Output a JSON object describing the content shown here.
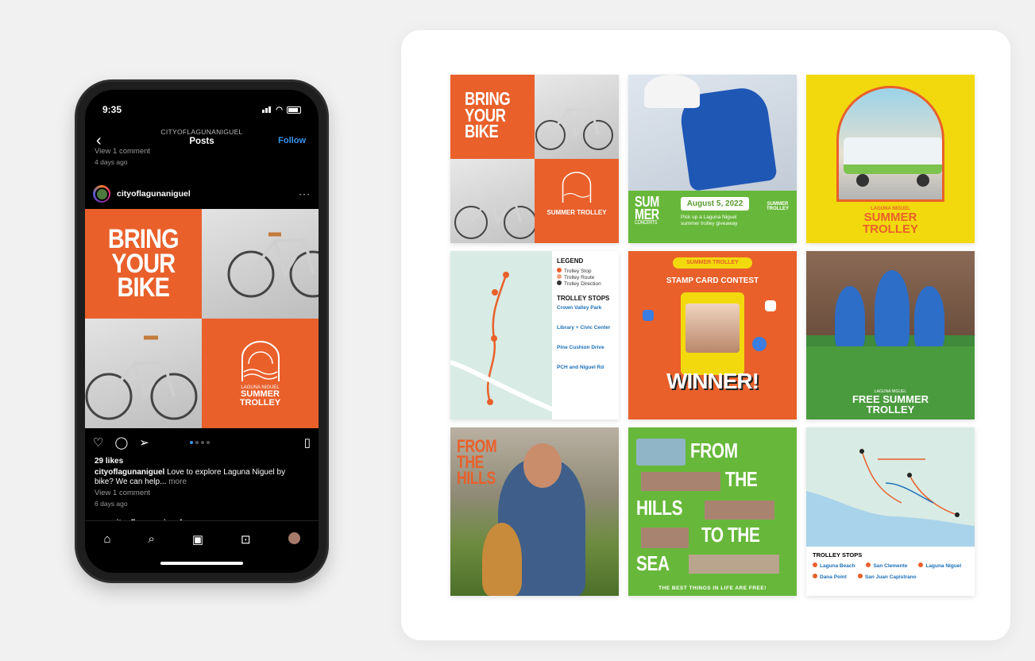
{
  "colors": {
    "orange": "#e9602b",
    "green": "#67b83a",
    "yellow": "#f2d90d",
    "blue": "#1c6fb8",
    "ig_blue": "#3897f0"
  },
  "phone": {
    "status_time": "9:35",
    "account": "CITYOFLAGUNANIGUEL",
    "title": "Posts",
    "follow": "Follow",
    "top_comment": "View 1 comment",
    "top_date": "4 days ago",
    "username": "cityoflagunaniguel",
    "post_text": {
      "line1": "BRING",
      "line2": "YOUR",
      "line3": "BIKE",
      "logo1": "LAGUNA NIGUEL",
      "logo2": "SUMMER",
      "logo3": "TROLLEY"
    },
    "likes": "29 likes",
    "caption_user": "cityoflagunaniguel",
    "caption_text": "Love to explore Laguna Niguel by bike? We can help...",
    "caption_more": "more",
    "view_comments": "View 1 comment",
    "date": "6 days ago",
    "next_user": "cityoflagunaniguel"
  },
  "grid": {
    "t1": {
      "a": "BRING",
      "b": "YOUR",
      "c": "BIKE",
      "logo": "SUMMER TROLLEY"
    },
    "t2": {
      "a": "SUM",
      "b": "MER",
      "c": "CONCERTS",
      "date": "August 5, 2022",
      "sub": "Pick up a Laguna Niguel summer trolley giveaway",
      "logo": "SUMMER TROLLEY"
    },
    "t3": {
      "a": "LAGUNA NIGUEL",
      "b": "SUMMER",
      "c": "TROLLEY"
    },
    "t4": {
      "legend": "LEGEND",
      "l1": "Trolley Stop",
      "l2": "Trolley Route",
      "l3": "Trolley Direction",
      "stops": "TROLLEY STOPS",
      "s1": "Crown Valley Park",
      "s2": "Library + Civic Center",
      "s3": "Pine Cushion Drive",
      "s4": "PCH and Niguel Rd"
    },
    "t5": {
      "badge": "SUMMER TROLLEY",
      "title": "STAMP CARD CONTEST",
      "winner": "WINNER!"
    },
    "t6": {
      "a": "LAGUNA NIGUEL",
      "b": "FREE SUMMER",
      "c": "TROLLEY"
    },
    "t7": {
      "a": "FROM",
      "b": "THE",
      "c": "HILLS"
    },
    "t8": {
      "a": "FROM",
      "b": "THE",
      "c": "HILLS",
      "d": "TO THE",
      "e": "SEA",
      "foot": "THE BEST THINGS IN LIFE ARE FREE!"
    },
    "t9": {
      "stops": "TROLLEY STOPS",
      "s1": "Laguna Beach",
      "s2": "San Clemente",
      "s3": "Laguna Niguel",
      "s4": "Dana Point",
      "s5": "San Juan Capistrano"
    }
  }
}
